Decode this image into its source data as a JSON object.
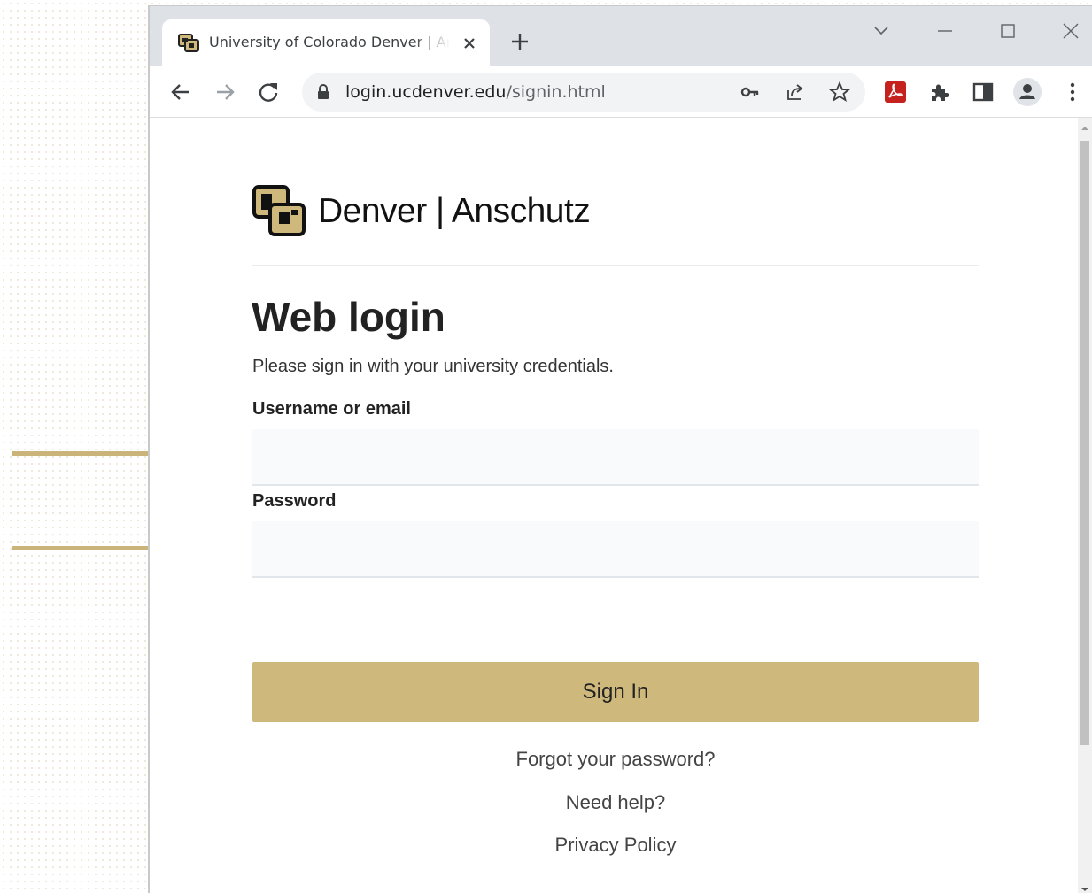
{
  "browser": {
    "tab_title": "University of Colorado Denver | Anschutz",
    "url_host": "login.ucdenver.edu",
    "url_path": "/signin.html"
  },
  "page": {
    "logo_text": "Denver | Anschutz",
    "heading": "Web login",
    "subtitle": "Please sign in with your university credentials.",
    "username_label": "Username or email",
    "username_value": "",
    "password_label": "Password",
    "password_value": "",
    "signin_button": "Sign In",
    "links": [
      "Forgot your password?",
      "Need help?",
      "Privacy Policy"
    ]
  },
  "annotations": {
    "arrow_color": "#cbb47a",
    "arrow_targets": [
      "username-field",
      "password-field"
    ]
  },
  "colors": {
    "brand_gold": "#cfb87c",
    "brand_black": "#111111",
    "field_bg": "#f8fafc"
  },
  "icons": [
    "back-arrow-icon",
    "forward-arrow-icon",
    "reload-icon",
    "lock-icon",
    "key-icon",
    "share-icon",
    "star-icon",
    "pdf-extension-icon",
    "puzzle-icon",
    "side-panel-icon",
    "profile-icon",
    "kebab-menu-icon"
  ]
}
